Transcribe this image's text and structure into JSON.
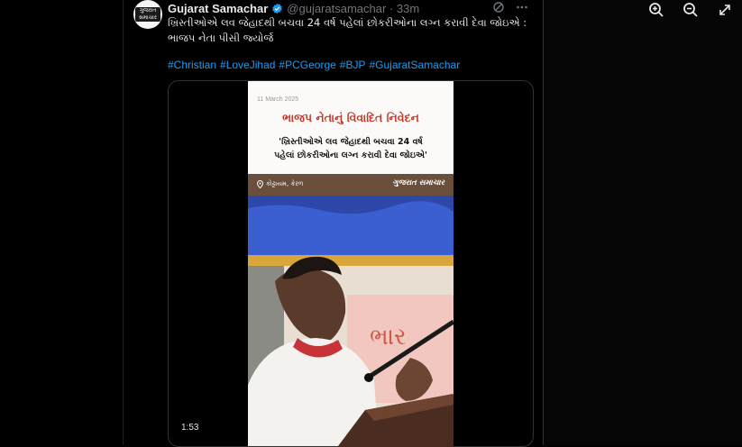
{
  "window_controls": {
    "zoom_in_icon": "zoom-in",
    "zoom_out_icon": "zoom-out",
    "expand_icon": "expand-arrows"
  },
  "tweet": {
    "author_name": "Gujarat Samachar",
    "avatar_text": "ગુજરાત સમાચાર",
    "handle_time": "@gujaratsamachar · 33m",
    "text": "ખ્રિસ્તીઓએ લવ જેહાદથી બચવા 24 વર્ષ પહેલાં છોકરીઓના લગ્ન કરાવી દેવા જોઇએ : ભાજપ નેતા પીસી જ્યોર્જ",
    "hashtags": [
      "#Christian",
      "#LoveJihad",
      "#PCGeorge",
      "#BJP",
      "#GujaratSamachar"
    ]
  },
  "video": {
    "date": "11 March 2025",
    "title": "ભાજપ નેતાનું વિવાદિત નિવેદન",
    "quote_line1": "'ખ્રિસ્તીઓએ લવ જેહાદથી બચવા 24 વર્ષ",
    "quote_line2": "પહેલાં છોકરીઓના લગ્ન કરાવી દેવા જોઇએ'",
    "location": "કોટ્ટાયમ, કેરળ",
    "brand": "ગુજરાત સમાચાર",
    "duration": "1:53"
  },
  "colors": {
    "accent": "#1d9bf0",
    "title_red": "#c0392b",
    "verified": "#1d9bf0"
  }
}
